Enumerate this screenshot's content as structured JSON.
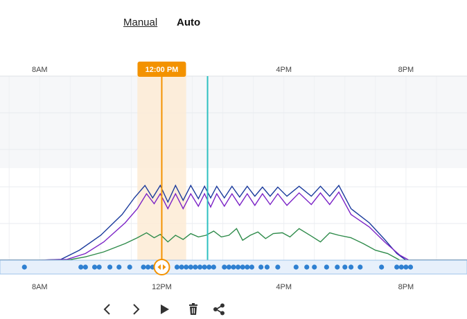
{
  "modes": {
    "manual_label": "Manual",
    "auto_label": "Auto",
    "active": "Auto"
  },
  "chart_data": {
    "type": "line",
    "x_unit": "hour of day",
    "xlim": [
      6.7,
      22.0
    ],
    "top_axis_ticks": [
      {
        "x": 8,
        "label": "8AM"
      },
      {
        "x": 16,
        "label": "4PM"
      },
      {
        "x": 20,
        "label": "8PM"
      }
    ],
    "bottom_axis_ticks": [
      {
        "x": 8,
        "label": "8AM"
      },
      {
        "x": 12,
        "label": "12PM"
      },
      {
        "x": 16,
        "label": "4PM"
      },
      {
        "x": 20,
        "label": "8PM"
      }
    ],
    "cursor": {
      "x": 12.0,
      "label": "12:00 PM",
      "window": [
        11.2,
        12.8
      ]
    },
    "marker_x": 13.5,
    "ylim": [
      0,
      100
    ],
    "grid": true,
    "series": [
      {
        "color": "#1a3a9c",
        "points": [
          [
            6.7,
            0
          ],
          [
            8.0,
            0
          ],
          [
            8.7,
            1
          ],
          [
            9.3,
            12
          ],
          [
            10.0,
            30
          ],
          [
            10.7,
            55
          ],
          [
            11.1,
            75
          ],
          [
            11.45,
            90
          ],
          [
            11.7,
            75
          ],
          [
            11.95,
            90
          ],
          [
            12.2,
            70
          ],
          [
            12.45,
            90
          ],
          [
            12.7,
            72
          ],
          [
            12.95,
            90
          ],
          [
            13.2,
            74
          ],
          [
            13.4,
            89
          ],
          [
            13.6,
            75
          ],
          [
            13.8,
            89
          ],
          [
            14.05,
            75
          ],
          [
            14.3,
            89
          ],
          [
            14.55,
            76
          ],
          [
            14.8,
            89
          ],
          [
            15.05,
            77
          ],
          [
            15.3,
            88
          ],
          [
            15.55,
            77
          ],
          [
            15.8,
            88
          ],
          [
            16.1,
            77
          ],
          [
            16.5,
            89
          ],
          [
            16.9,
            77
          ],
          [
            17.2,
            89
          ],
          [
            17.5,
            77
          ],
          [
            17.8,
            90
          ],
          [
            18.2,
            62
          ],
          [
            18.8,
            45
          ],
          [
            19.3,
            25
          ],
          [
            19.7,
            8
          ],
          [
            20.0,
            0
          ],
          [
            22.0,
            0
          ]
        ]
      },
      {
        "color": "#7b22c6",
        "points": [
          [
            6.7,
            0
          ],
          [
            8.0,
            0
          ],
          [
            8.9,
            1
          ],
          [
            9.5,
            8
          ],
          [
            10.1,
            22
          ],
          [
            10.8,
            45
          ],
          [
            11.2,
            62
          ],
          [
            11.5,
            80
          ],
          [
            11.75,
            68
          ],
          [
            11.95,
            80
          ],
          [
            12.2,
            62
          ],
          [
            12.45,
            80
          ],
          [
            12.7,
            62
          ],
          [
            12.95,
            80
          ],
          [
            13.2,
            65
          ],
          [
            13.4,
            80
          ],
          [
            13.6,
            64
          ],
          [
            13.8,
            80
          ],
          [
            14.05,
            65
          ],
          [
            14.3,
            80
          ],
          [
            14.55,
            66
          ],
          [
            14.8,
            80
          ],
          [
            15.05,
            66
          ],
          [
            15.3,
            80
          ],
          [
            15.55,
            67
          ],
          [
            15.8,
            80
          ],
          [
            16.1,
            66
          ],
          [
            16.5,
            81
          ],
          [
            16.9,
            67
          ],
          [
            17.2,
            81
          ],
          [
            17.5,
            67
          ],
          [
            17.8,
            82
          ],
          [
            18.2,
            55
          ],
          [
            18.8,
            40
          ],
          [
            19.3,
            22
          ],
          [
            19.8,
            6
          ],
          [
            20.1,
            0
          ],
          [
            22.0,
            0
          ]
        ]
      },
      {
        "color": "#2e8b4a",
        "points": [
          [
            6.7,
            0
          ],
          [
            8.0,
            0
          ],
          [
            8.9,
            0
          ],
          [
            9.5,
            4
          ],
          [
            10.1,
            10
          ],
          [
            10.8,
            20
          ],
          [
            11.2,
            27
          ],
          [
            11.5,
            33
          ],
          [
            11.75,
            27
          ],
          [
            11.95,
            31
          ],
          [
            12.2,
            22
          ],
          [
            12.45,
            30
          ],
          [
            12.7,
            25
          ],
          [
            12.95,
            32
          ],
          [
            13.2,
            28
          ],
          [
            13.45,
            30
          ],
          [
            13.7,
            35
          ],
          [
            13.95,
            28
          ],
          [
            14.2,
            30
          ],
          [
            14.45,
            38
          ],
          [
            14.65,
            24
          ],
          [
            14.9,
            30
          ],
          [
            15.15,
            34
          ],
          [
            15.4,
            26
          ],
          [
            15.65,
            32
          ],
          [
            15.95,
            33
          ],
          [
            16.2,
            28
          ],
          [
            16.5,
            38
          ],
          [
            16.9,
            29
          ],
          [
            17.2,
            22
          ],
          [
            17.5,
            33
          ],
          [
            17.8,
            30
          ],
          [
            18.2,
            27
          ],
          [
            18.6,
            20
          ],
          [
            19.0,
            12
          ],
          [
            19.4,
            8
          ],
          [
            19.8,
            0
          ],
          [
            22.0,
            0
          ]
        ]
      }
    ],
    "event_dots_x": [
      7.5,
      9.35,
      9.5,
      9.8,
      9.95,
      10.3,
      10.6,
      10.95,
      11.4,
      11.55,
      11.7,
      11.85,
      12.5,
      12.65,
      12.8,
      12.95,
      13.1,
      13.25,
      13.4,
      13.55,
      13.7,
      14.05,
      14.2,
      14.35,
      14.5,
      14.65,
      14.8,
      14.95,
      15.25,
      15.45,
      15.8,
      16.4,
      16.75,
      17.0,
      17.4,
      17.75,
      18.0,
      18.2,
      18.5,
      19.2,
      19.7,
      19.85,
      20.0,
      20.15
    ]
  },
  "controls": [
    {
      "name": "previous-button",
      "icon": "chevron-left-icon"
    },
    {
      "name": "next-button",
      "icon": "chevron-right-icon"
    },
    {
      "name": "play-button",
      "icon": "play-icon"
    },
    {
      "name": "delete-button",
      "icon": "trash-icon"
    },
    {
      "name": "share-button",
      "icon": "share-icon"
    }
  ]
}
